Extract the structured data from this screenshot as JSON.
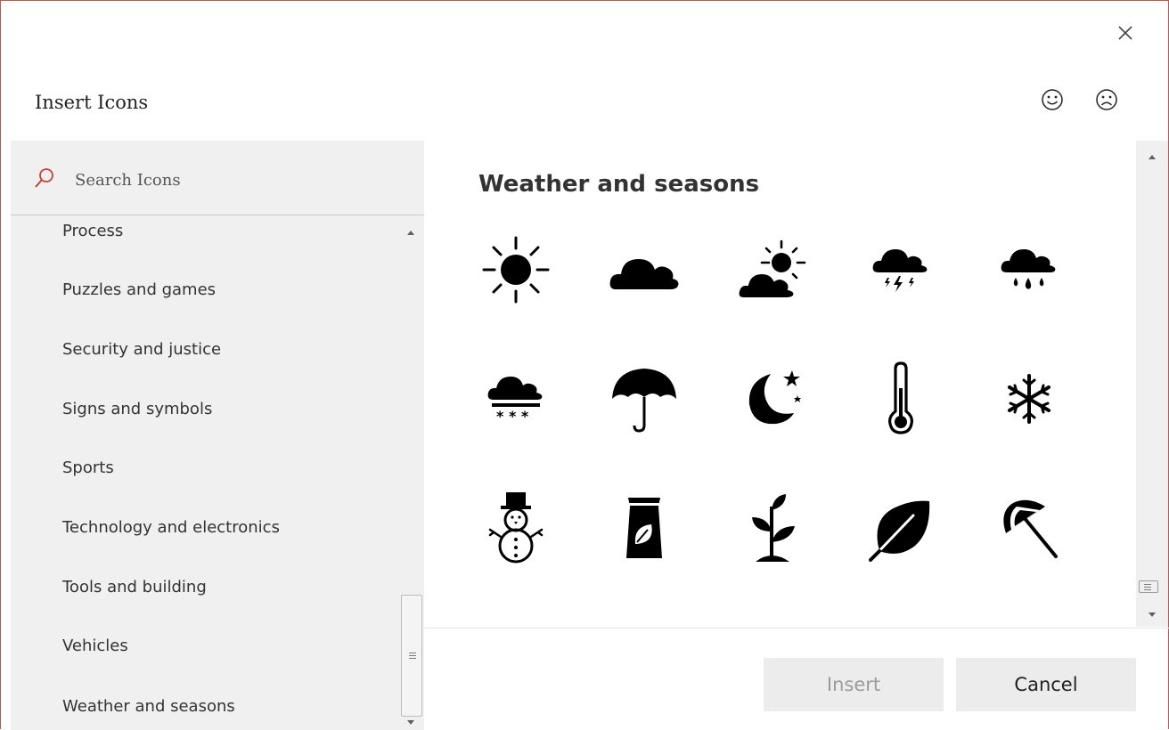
{
  "dialog": {
    "title": "Insert Icons",
    "close_icon": "close-icon",
    "feedback_happy_icon": "smiley-face-icon",
    "feedback_sad_icon": "frowny-face-icon"
  },
  "search": {
    "placeholder": "Search Icons",
    "value": "",
    "icon": "search-icon"
  },
  "categories": [
    "Process",
    "Puzzles and games",
    "Security and justice",
    "Signs and symbols",
    "Sports",
    "Technology and electronics",
    "Tools and building",
    "Vehicles",
    "Weather and seasons"
  ],
  "section": {
    "title": "Weather and seasons",
    "icons": [
      "sun-icon",
      "cloud-icon",
      "partly-sunny-icon",
      "thunderstorm-icon",
      "rain-icon",
      "snow-cloud-icon",
      "umbrella-icon",
      "moon-and-stars-icon",
      "thermometer-icon",
      "snowflake-icon",
      "snowman-icon",
      "seed-bag-icon",
      "sprout-icon",
      "leaf-icon",
      "beach-umbrella-icon"
    ]
  },
  "buttons": {
    "insert": "Insert",
    "cancel": "Cancel"
  },
  "colors": {
    "frame_border": "#b9594a",
    "search_icon": "#c8412f",
    "panel_bg": "#f0f0f0",
    "disabled_text": "#9b9b9b"
  }
}
